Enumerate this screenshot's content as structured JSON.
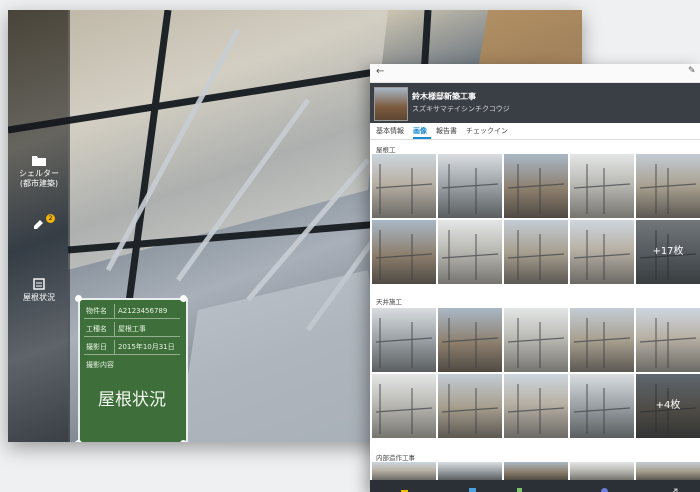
{
  "tablet": {
    "sidebar": [
      {
        "label": "シェルター\n(都市建築)",
        "icon": "folder-icon"
      },
      {
        "label": "",
        "icon": "edit-icon",
        "badge": "2"
      },
      {
        "label": "屋根状況",
        "icon": "board-icon"
      }
    ],
    "board": {
      "rows": [
        {
          "key": "物件名",
          "value": "A2123456789"
        },
        {
          "key": "工種名",
          "value": "屋根工事"
        },
        {
          "key": "撮影日",
          "value": "2015年10月31日"
        },
        {
          "key": "撮影内容",
          "value": ""
        }
      ],
      "main_text": "屋根状況"
    }
  },
  "panel": {
    "project_title": "鈴木様邸新築工事",
    "project_subtitle": "スズキサマテイシンチクコウジ",
    "tabs": [
      "基本情報",
      "画像",
      "報告書",
      "チェックイン"
    ],
    "active_tab": "画像",
    "sections": [
      {
        "title": "屋根工",
        "more_label": "+17枚"
      },
      {
        "title": "天井施工",
        "more_label": "+4枚"
      },
      {
        "title": "内部造作工事",
        "more_label": ""
      }
    ]
  },
  "colors": {
    "accent": "#1a8bd6",
    "board_green": "#3e6f3a",
    "dark_bar": "#3a3f45"
  }
}
